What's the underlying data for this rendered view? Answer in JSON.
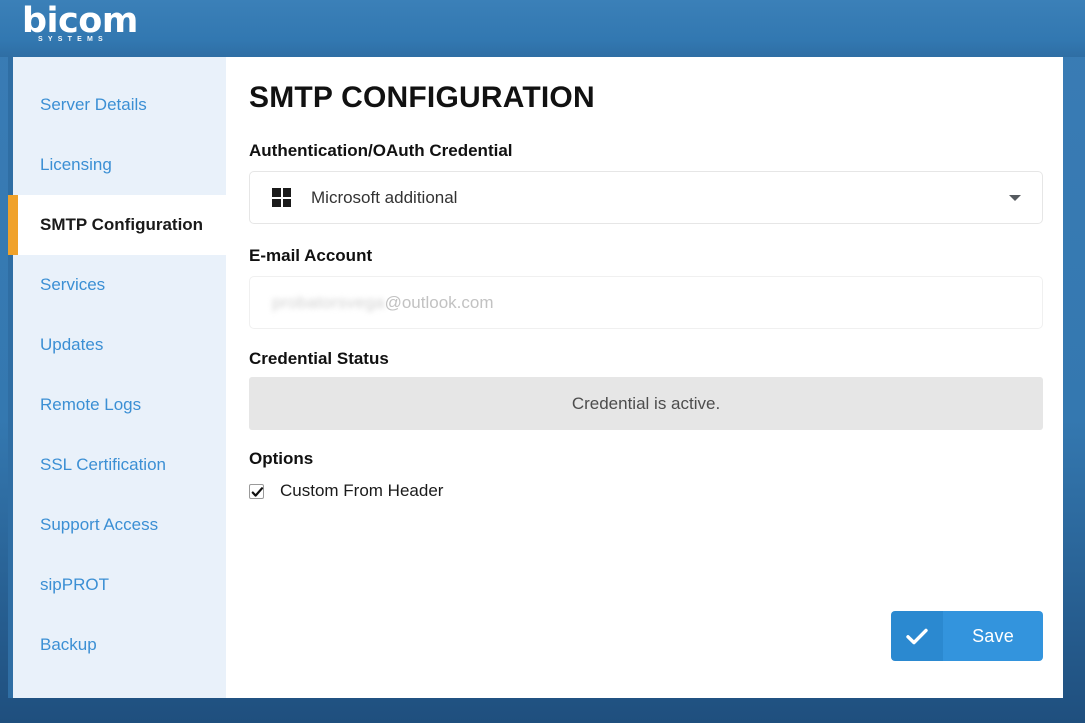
{
  "brand": {
    "logo_word": "bicom",
    "logo_subtitle": "SYSTEMS",
    "header_color": "#3278b1",
    "accent_color": "#f0a22b",
    "link_color": "#3b8fd4"
  },
  "sidebar": {
    "items": [
      {
        "label": "Server Details",
        "active": false
      },
      {
        "label": "Licensing",
        "active": false
      },
      {
        "label": "SMTP Configuration",
        "active": true
      },
      {
        "label": "Services",
        "active": false
      },
      {
        "label": "Updates",
        "active": false
      },
      {
        "label": "Remote Logs",
        "active": false
      },
      {
        "label": "SSL Certification",
        "active": false
      },
      {
        "label": "Support Access",
        "active": false
      },
      {
        "label": "sipPROT",
        "active": false
      },
      {
        "label": "Backup",
        "active": false
      }
    ]
  },
  "main": {
    "page_title": "SMTP CONFIGURATION",
    "credential": {
      "label": "Authentication/OAuth Credential",
      "selected_value": "Microsoft additional",
      "icon": "microsoft-windows-icon",
      "caret_icon": "chevron-down-icon"
    },
    "email": {
      "label": "E-mail Account",
      "value_masked": "probatorsvega",
      "value_domain": "@outlook.com"
    },
    "status": {
      "label": "Credential Status",
      "text": "Credential is active.",
      "background": "#e6e6e6"
    },
    "options": {
      "label": "Options",
      "items": [
        {
          "label": "Custom From Header",
          "checked": true
        }
      ]
    },
    "save": {
      "label": "Save",
      "icon": "check-icon",
      "color": "#3394dd"
    }
  }
}
